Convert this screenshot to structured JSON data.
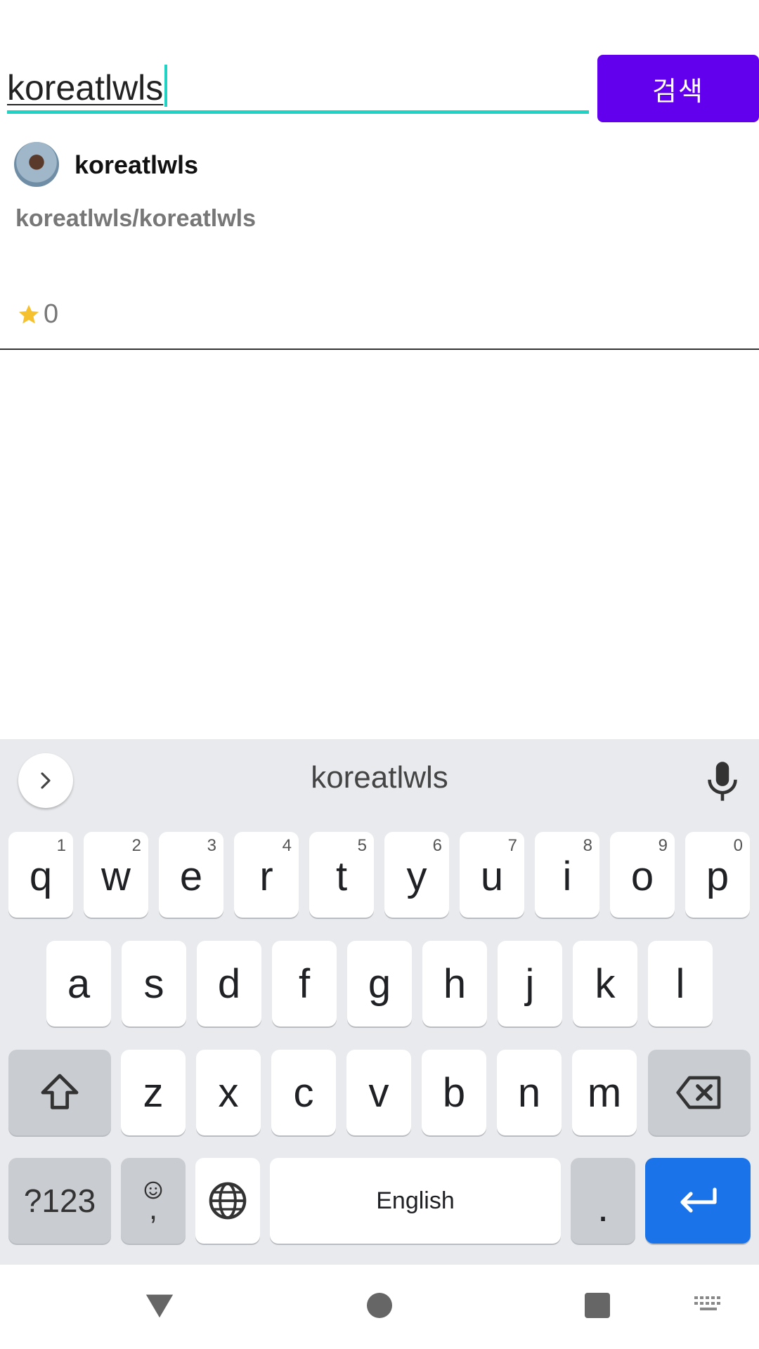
{
  "search": {
    "query": "koreatlwls",
    "button_label": "검색"
  },
  "result": {
    "owner": "koreatlwls",
    "full_name": "koreatlwls/koreatlwls",
    "stars": "0",
    "star_color": "#f6c12f"
  },
  "keyboard": {
    "suggestion": "koreatlwls",
    "row1": [
      {
        "key": "q",
        "hint": "1"
      },
      {
        "key": "w",
        "hint": "2"
      },
      {
        "key": "e",
        "hint": "3"
      },
      {
        "key": "r",
        "hint": "4"
      },
      {
        "key": "t",
        "hint": "5"
      },
      {
        "key": "y",
        "hint": "6"
      },
      {
        "key": "u",
        "hint": "7"
      },
      {
        "key": "i",
        "hint": "8"
      },
      {
        "key": "o",
        "hint": "9"
      },
      {
        "key": "p",
        "hint": "0"
      }
    ],
    "row2": [
      "a",
      "s",
      "d",
      "f",
      "g",
      "h",
      "j",
      "k",
      "l"
    ],
    "row3": [
      "z",
      "x",
      "c",
      "v",
      "b",
      "n",
      "m"
    ],
    "symbols_label": "?123",
    "comma_label": ",",
    "space_label": "English",
    "period_label": "."
  },
  "colors": {
    "accent": "#6200ee",
    "input_underline": "#1ed3c4",
    "enter_key": "#1a73e8"
  }
}
